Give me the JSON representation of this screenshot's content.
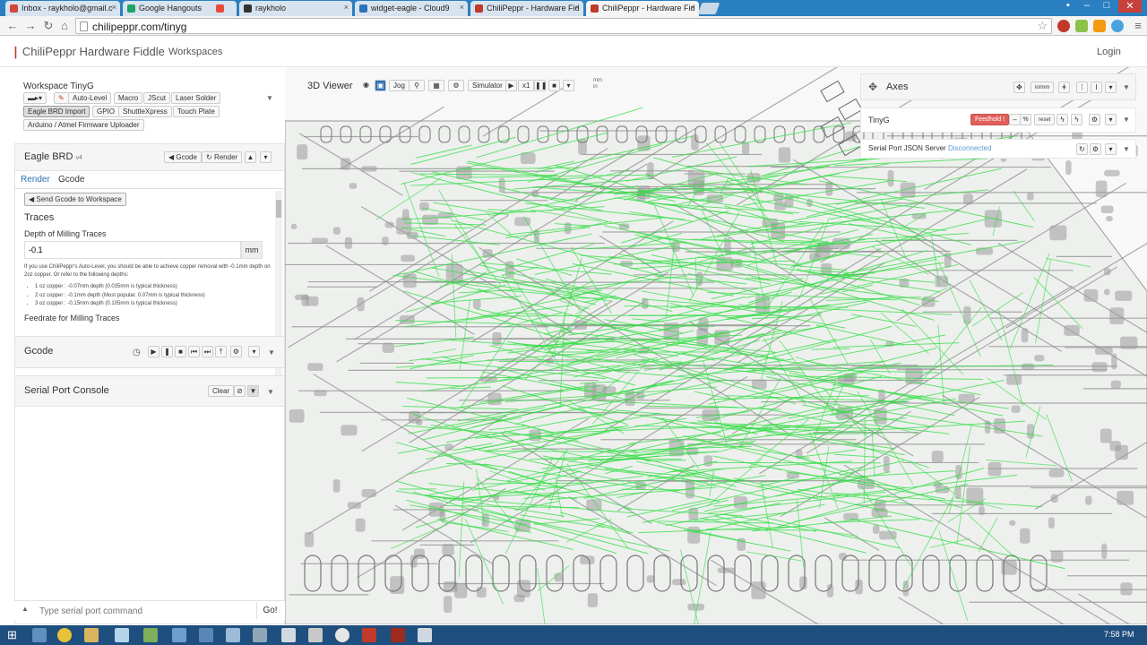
{
  "browser": {
    "tabs": [
      {
        "title": "Inbox - raykholo@gmail.c",
        "color": "#d44638"
      },
      {
        "title": "Google Hangouts",
        "color": "#1da462"
      },
      {
        "title": "",
        "color": "#e84a3a"
      },
      {
        "title": "raykholo",
        "color": "#333333"
      },
      {
        "title": "widget-eagle - Cloud9",
        "color": "#2c72b7"
      },
      {
        "title": "ChiliPeppr - Hardware Fid",
        "color": "#c0392b"
      },
      {
        "title": "ChiliPeppr - Hardware Fid",
        "color": "#c0392b"
      }
    ],
    "url": "chilipeppr.com/tinyg"
  },
  "app": {
    "brand": "ChiliPeppr Hardware Fiddle",
    "workspaces": "Workspaces",
    "login": "Login"
  },
  "workspace": {
    "title": "Workspace TinyG",
    "buttons_row1": [
      "Auto-Level",
      "Macro",
      "JScut",
      "Laser Solder"
    ],
    "buttons_row2": [
      "Eagle BRD Import",
      "GPIO",
      "ShuttleXpress",
      "Touch Plate"
    ],
    "buttons_row3": [
      "Arduino / Atmel Firmware Uploader"
    ]
  },
  "eagle": {
    "title": "Eagle BRD",
    "version": "v4",
    "gcode_btn": "Gcode",
    "render_btn": "Render",
    "tab_render": "Render",
    "tab_gcode": "Gcode",
    "send_btn": "Send Gcode to Workspace",
    "traces_heading": "Traces",
    "depth_label": "Depth of Milling Traces",
    "depth_value": "-0.1",
    "depth_unit": "mm",
    "help_text": "If you use ChiliPeppr's Auto-Level, you should be able to achieve copper removal with -0.1mm depth on 2oz copper. Or refer to the following depths:",
    "bullets": [
      "1 oz copper : -0.07mm depth (0.035mm is typical thickness)",
      "2 oz copper : -0.1mm depth (Most popular. 0.07mm is typical thickness)",
      "3 oz copper : -0.15mm depth (0.105mm is typical thickness)"
    ],
    "feedrate_label": "Feedrate for Milling Traces"
  },
  "gcode_panel": {
    "title": "Gcode"
  },
  "console": {
    "title": "Serial Port Console",
    "clear": "Clear",
    "input_placeholder": "Type serial port command",
    "go": "Go!"
  },
  "viewer": {
    "title": "3D Viewer",
    "jog": "Jog",
    "simulator": "Simulator",
    "speed": "x1",
    "units_top": "mm",
    "units_bottom": "in",
    "trace_color": "#33dd44"
  },
  "axes": {
    "title": "Axes",
    "inmm": "in/mm"
  },
  "tinyg": {
    "title": "TinyG",
    "feedhold": "Feedhold !",
    "pct": "%",
    "reset": "reset",
    "feedhold_color": "#e0605a"
  },
  "spjs": {
    "label": "Serial Port JSON Server",
    "status": "Disconnected",
    "status_color": "#5b9bd5"
  },
  "taskbar": {
    "clock": "7:58 PM"
  }
}
